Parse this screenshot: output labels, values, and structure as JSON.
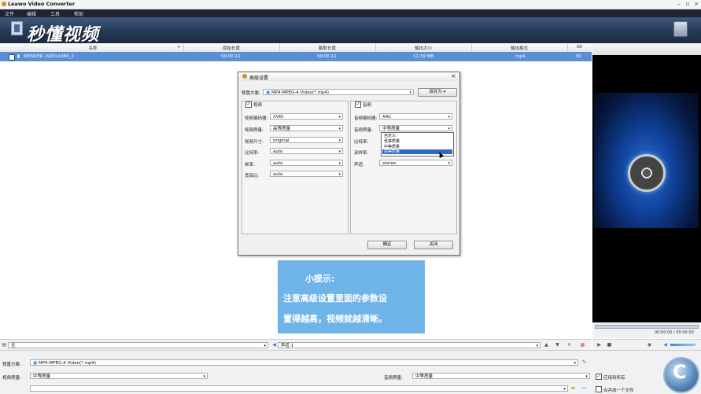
{
  "window": {
    "title": "Leawo Video Converter"
  },
  "menu": [
    "文件",
    "编辑",
    "工具",
    "帮助"
  ],
  "banner": {
    "brand": "秒懂视频"
  },
  "list": {
    "headers": [
      "名称",
      "原始长度",
      "截取长度",
      "输出大小",
      "输出格式",
      "3D"
    ],
    "rows": [
      {
        "name": "REINDER 1920x1080_2",
        "original": "00:00:11",
        "cut": "00:00:11",
        "size": "11.39 MB",
        "format": "mp4",
        "td": "3D"
      }
    ]
  },
  "dialog": {
    "title": "高级设置",
    "preset_label": "预置方案:",
    "preset_value": "MP4-MPEG-4 Video(*.mp4)",
    "save_as": "保存为",
    "video": {
      "title": "视频",
      "codec_label": "视频编码器:",
      "codec_value": "XVID",
      "quality_label": "视频质量:",
      "quality_value": "高等质量",
      "size_label": "视频尺寸:",
      "size_value": "original",
      "bitrate_label": "比特率:",
      "bitrate_value": "auto",
      "framerate_label": "帧率:",
      "framerate_value": "auto",
      "aspect_label": "宽高比:",
      "aspect_value": "auto"
    },
    "audio": {
      "title": "音频",
      "codec_label": "音频编码器:",
      "codec_value": "AAC",
      "quality_label": "音频质量:",
      "quality_value": "中等质量",
      "bitrate_label": "比特率:",
      "samplerate_label": "采样率:",
      "channel_label": "声道:",
      "channel_value": "stereo",
      "quality_options": [
        "自定义",
        "低等质量",
        "中等质量",
        "高等质量"
      ],
      "quality_selected_index": 3
    },
    "ok": "确定",
    "close": "关闭"
  },
  "tip": {
    "heading": "小提示:",
    "line1": "注意高级设置里面的参数设",
    "line2": "置得越高，视频就越清晰。"
  },
  "subbar": {
    "subtitle": "无",
    "audio_track": "声道 1"
  },
  "bottom": {
    "preset_label": "预置方案:",
    "preset_value": "MP4-MPEG-4 Video(*.mp4)",
    "video_quality_label": "视频质量:",
    "video_quality_value": "中等质量",
    "audio_quality_label": "音频质量:",
    "audio_quality_value": "中等质量",
    "apply_all": "应用到所有",
    "merge": "合并成一个文件"
  },
  "player": {
    "time": "00:00:00 / 00:00:00"
  },
  "colors": {
    "accent": "#316ac5",
    "selected_row": "#5a8fd6",
    "tip_bg": "#6fb4e8",
    "banner": "#2e4565"
  }
}
